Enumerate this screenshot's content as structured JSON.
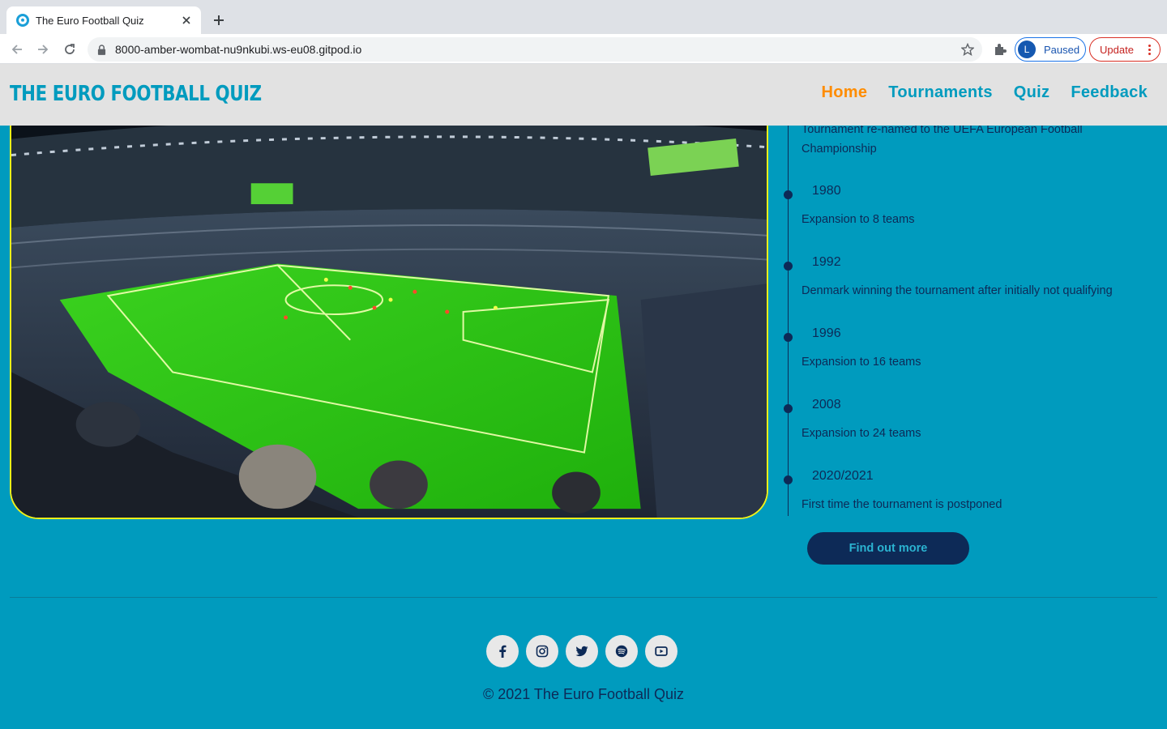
{
  "browser": {
    "tab_title": "The Euro Football Quiz",
    "url": "8000-amber-wombat-nu9nkubi.ws-eu08.gitpod.io",
    "profile_initial": "L",
    "profile_status": "Paused",
    "update_label": "Update"
  },
  "site": {
    "brand": "THE EURO FOOTBALL QUIZ",
    "nav": [
      "Home",
      "Tournaments",
      "Quiz",
      "Feedback"
    ],
    "active_nav": "Home",
    "accent_color": "#ff8c00",
    "primary_color": "#009bbe",
    "dark_color": "#0d2a57"
  },
  "hero": {
    "image": "stadium-photo"
  },
  "timeline": {
    "intro_text": "Tournament re-named to the UEFA European Football Championship",
    "events": [
      {
        "year": "1980",
        "text": "Expansion to 8 teams"
      },
      {
        "year": "1992",
        "text": "Denmark winning the tournament after initially not qualifying"
      },
      {
        "year": "1996",
        "text": "Expansion to 16 teams"
      },
      {
        "year": "2008",
        "text": "Expansion to 24 teams"
      },
      {
        "year": "2020/2021",
        "text": "First time the tournament is postponed"
      }
    ]
  },
  "cta": {
    "label": "Find out more"
  },
  "footer": {
    "socials": [
      "facebook-icon",
      "instagram-icon",
      "twitter-icon",
      "spotify-icon",
      "youtube-icon"
    ],
    "copyright": "© 2021 The Euro Football Quiz"
  }
}
